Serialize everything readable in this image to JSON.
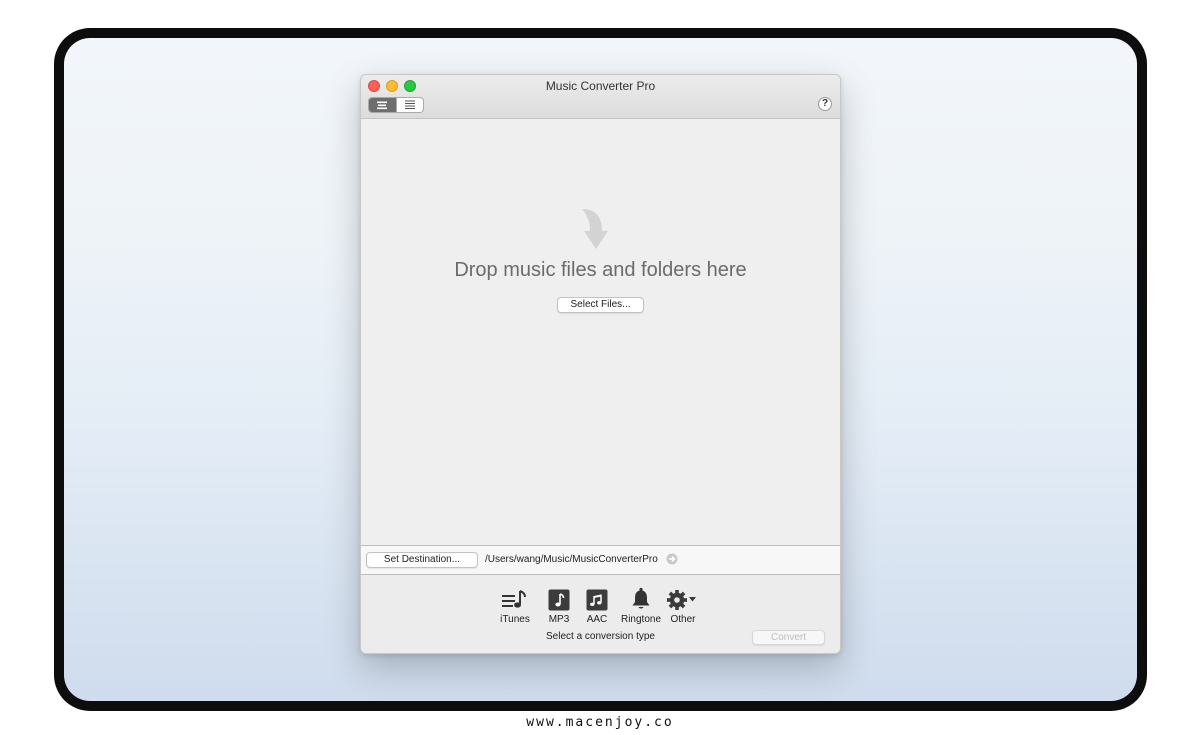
{
  "window": {
    "title": "Music Converter Pro",
    "help_label": "?"
  },
  "toolbar": {
    "view_modes": [
      "compact-view",
      "list-view"
    ],
    "active_view": "compact-view"
  },
  "drop_area": {
    "message": "Drop music files and folders here",
    "select_button": "Select Files..."
  },
  "destination": {
    "button_label": "Set Destination...",
    "path": "/Users/wang/Music/MusicConverterPro"
  },
  "conversion": {
    "types": [
      {
        "label": "iTunes",
        "icon": "itunes-icon"
      },
      {
        "label": "MP3",
        "icon": "mp3-icon"
      },
      {
        "label": "AAC",
        "icon": "aac-icon"
      },
      {
        "label": "Ringtone",
        "icon": "bell-icon"
      },
      {
        "label": "Other",
        "icon": "gear-icon"
      }
    ],
    "status": "Select a conversion type",
    "convert_label": "Convert"
  },
  "footer": {
    "watermark": "www.macenjoy.co"
  },
  "colors": {
    "close": "#fc5f57",
    "minimize": "#fdbc2e",
    "maximize": "#28c840"
  }
}
